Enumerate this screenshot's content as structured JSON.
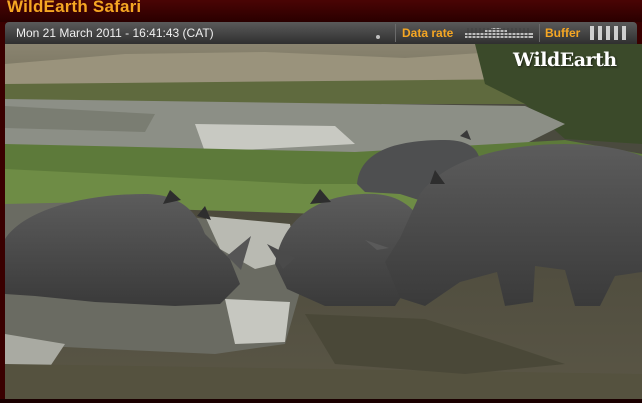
{
  "app": {
    "title": "WildEarth Safari"
  },
  "infobar": {
    "timestamp": "Mon 21 March 2011 - 16:41:43 (CAT)",
    "data_rate_label": "Data rate",
    "buffer_label": "Buffer"
  },
  "video": {
    "watermark": "WildEarth"
  },
  "colors": {
    "accent": "#f5a623",
    "frame": "#3a0000",
    "infobar": "#3f3f3f"
  }
}
